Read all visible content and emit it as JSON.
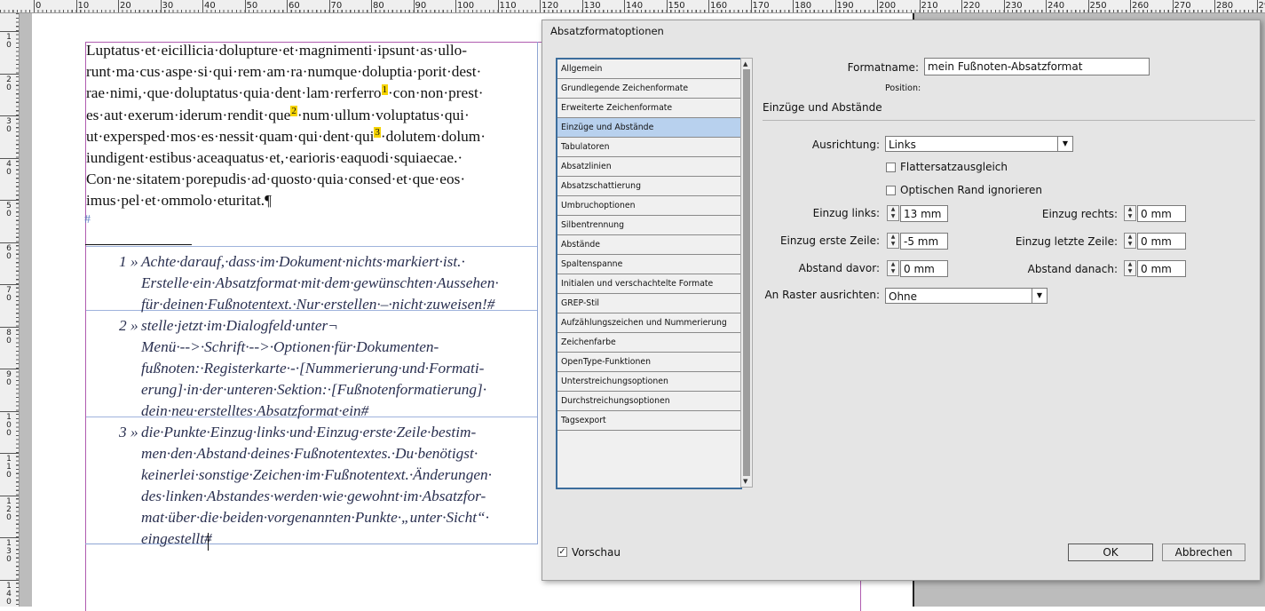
{
  "ruler": {
    "h_labels": [
      "0",
      "10",
      "20",
      "30",
      "40",
      "50",
      "60",
      "70",
      "80",
      "90",
      "100",
      "110",
      "120",
      "130",
      "140",
      "150",
      "160",
      "170",
      "180",
      "190",
      "200",
      "210",
      "220",
      "230",
      "240",
      "250",
      "260",
      "270",
      "280",
      "290"
    ],
    "v_labels": [
      "10",
      "20",
      "30",
      "40",
      "50",
      "60",
      "70",
      "80",
      "90",
      "100",
      "110",
      "120",
      "130",
      "140"
    ]
  },
  "document": {
    "body_lines": [
      "Luptatus·et·eicillicia·dolupture·et·magnimenti·ipsunt·as·ullo-",
      "runt·ma·cus·aspe·si·qui·rem·am·ra·numque·doluptia·porit·dest·",
      "rae·nimi,·que·doluptatus·quia·dent·lam·rerferro",
      "·con·non·prest·",
      "es·aut·exerum·iderum·rendit·que",
      "·num·ullum·voluptatus·qui·",
      "ut·expersped·mos·es·nessit·quam·qui·dent·qui",
      "·dolutem·dolum·",
      "iundigent·estibus·aceaquatus·et,·earioris·eaquodi·squiaecae.·",
      "Con·ne·sitatem·porepudis·ad·quosto·quia·consed·et·que·eos·",
      "imus·pel·et·ommolo·eturitat.¶"
    ],
    "footnote_marks": [
      "1",
      "2",
      "3"
    ],
    "hash": "#",
    "footnotes": [
      {
        "num": "1 »",
        "lines": [
          "Achte·darauf,·dass·im·Dokument·nichts·markiert·ist.·",
          "Erstelle·ein·Absatzformat·mit·dem·gewünschten·Aussehen·",
          "für·deinen·Fußnotentext.·Nur·erstellen·–·nicht·zuweisen!#"
        ]
      },
      {
        "num": "2 »",
        "lines": [
          "stelle·jetzt·im·Dialogfeld·unter¬",
          "Menü·-->·Schrift·-->·Optionen·für·Dokumenten-",
          "fußnoten:·Registerkarte·-·[Nummerierung·und·Formati-",
          "erung]·in·der·unteren·Sektion:·[Fußnotenformatierung]·",
          "dein·neu·erstelltes·Absatzformat·ein#"
        ]
      },
      {
        "num": "3 »",
        "lines": [
          "die·Punkte·Einzug·links·und·Einzug·erste·Zeile·bestim-",
          "men·den·Abstand·deines·Fußnotentextes.·Du·benötigst·",
          "keinerlei·sonstige·Zeichen·im·Fußnotentext.·Änderungen·",
          "des·linken·Abstandes·werden·wie·gewohnt·im·Absatzfor-",
          "mat·über·die·beiden·vorgenannten·Punkte·„unter·Sicht“·",
          "eingestellt#"
        ]
      }
    ]
  },
  "dialog": {
    "title": "Absatzformatoptionen",
    "categories": [
      "Allgemein",
      "Grundlegende Zeichenformate",
      "Erweiterte Zeichenformate",
      "Einzüge und Abstände",
      "Tabulatoren",
      "Absatzlinien",
      "Absatzschattierung",
      "Umbruchoptionen",
      "Silbentrennung",
      "Abstände",
      "Spaltenspanne",
      "Initialen und verschachtelte Formate",
      "GREP-Stil",
      "Aufzählungszeichen und Nummerierung",
      "Zeichenfarbe",
      "OpenType-Funktionen",
      "Unterstreichungsoptionen",
      "Durchstreichungsoptionen",
      "Tagsexport"
    ],
    "selected_category": "Einzüge und Abstände",
    "formatname_label": "Formatname:",
    "formatname_value": "mein Fußnoten-Absatzformat",
    "position_label": "Position:",
    "section_title": "Einzüge und Abstände",
    "ausrichtung_label": "Ausrichtung:",
    "ausrichtung_value": "Links",
    "flattersatz_label": "Flattersatzausgleich",
    "flattersatz_checked": false,
    "optisch_label": "Optischen Rand ignorieren",
    "optisch_checked": false,
    "einzug_links_label": "Einzug links:",
    "einzug_links_value": "13 mm",
    "einzug_rechts_label": "Einzug rechts:",
    "einzug_rechts_value": "0 mm",
    "einzug_erste_label": "Einzug erste Zeile:",
    "einzug_erste_value": "-5 mm",
    "einzug_letzte_label": "Einzug letzte Zeile:",
    "einzug_letzte_value": "0 mm",
    "abstand_davor_label": "Abstand davor:",
    "abstand_davor_value": "0 mm",
    "abstand_danach_label": "Abstand danach:",
    "abstand_danach_value": "0 mm",
    "raster_label": "An Raster ausrichten:",
    "raster_value": "Ohne",
    "vorschau_label": "Vorschau",
    "vorschau_checked": true,
    "ok_label": "OK",
    "cancel_label": "Abbrechen"
  }
}
